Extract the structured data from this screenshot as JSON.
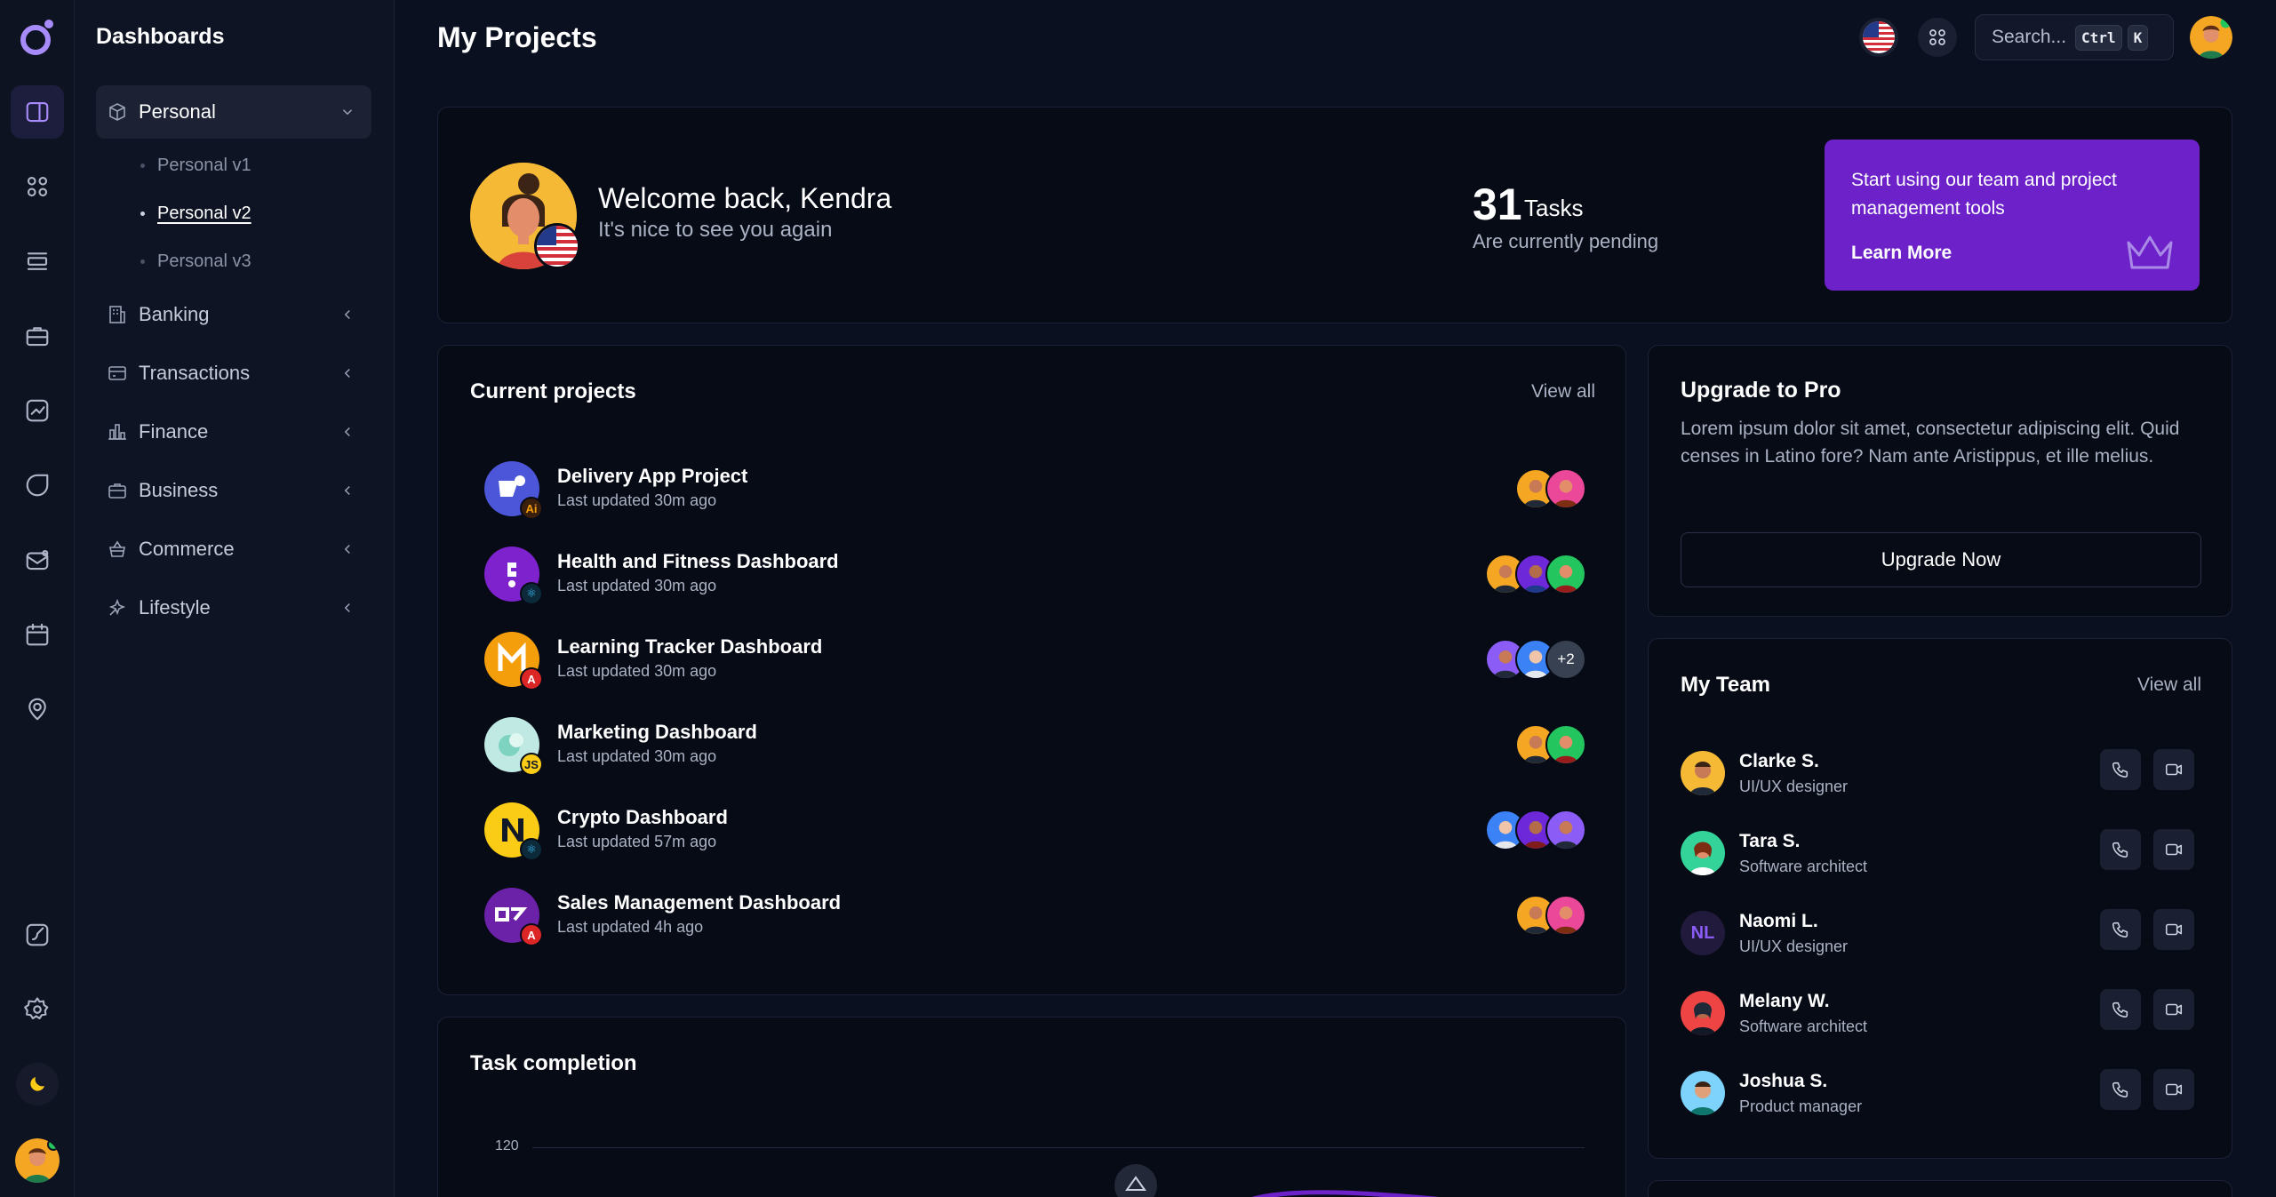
{
  "sidebar": {
    "title": "Dashboards",
    "groups": [
      {
        "label": "Personal",
        "icon": "box-icon",
        "expanded": true
      },
      {
        "label": "Banking",
        "icon": "building-icon"
      },
      {
        "label": "Transactions",
        "icon": "card-icon"
      },
      {
        "label": "Finance",
        "icon": "chart-bar-icon"
      },
      {
        "label": "Business",
        "icon": "briefcase-icon"
      },
      {
        "label": "Commerce",
        "icon": "basket-icon"
      },
      {
        "label": "Lifestyle",
        "icon": "sparkles-icon"
      }
    ],
    "personal_sub": [
      "Personal v1",
      "Personal v2",
      "Personal v3"
    ],
    "active_sub": "Personal v2"
  },
  "header": {
    "title": "My Projects",
    "search_label": "Search...",
    "kbd_ctrl": "Ctrl",
    "kbd_k": "K"
  },
  "welcome": {
    "title": "Welcome back, Kendra",
    "subtitle": "It's nice to see you again",
    "task_count": "31",
    "task_label": "Tasks",
    "task_sub": "Are currently pending",
    "promo_text": "Start using our team and project management tools",
    "promo_link": "Learn More"
  },
  "projects": {
    "title": "Current projects",
    "view_all": "View all",
    "items": [
      {
        "name": "Delivery App Project",
        "updated": "Last updated 30m ago",
        "badge": "Ai"
      },
      {
        "name": "Health and Fitness Dashboard",
        "updated": "Last updated 30m ago",
        "badge": "⚛"
      },
      {
        "name": "Learning Tracker Dashboard",
        "updated": "Last updated 30m ago",
        "badge": "A"
      },
      {
        "name": "Marketing Dashboard",
        "updated": "Last updated 30m ago",
        "badge": "JS"
      },
      {
        "name": "Crypto Dashboard",
        "updated": "Last updated 57m ago",
        "badge": "⚛"
      },
      {
        "name": "Sales Management Dashboard",
        "updated": "Last updated 4h ago",
        "badge": "A"
      }
    ],
    "extra_members": "+2"
  },
  "task_completion": {
    "title": "Task completion",
    "tick_top": "120"
  },
  "upgrade": {
    "title": "Upgrade to Pro",
    "body": "Lorem ipsum dolor sit amet, consectetur adipiscing elit. Quid censes in Latino fore? Nam ante Aristippus, et ille melius.",
    "button": "Upgrade Now"
  },
  "team": {
    "title": "My Team",
    "view_all": "View all",
    "members": [
      {
        "name": "Clarke S.",
        "role": "UI/UX designer"
      },
      {
        "name": "Tara S.",
        "role": "Software architect"
      },
      {
        "name": "Naomi L.",
        "role": "UI/UX designer",
        "initials": "NL"
      },
      {
        "name": "Melany W.",
        "role": "Software architect"
      },
      {
        "name": "Joshua S.",
        "role": "Product manager"
      }
    ]
  },
  "colors": {
    "accent": "#6d21c9",
    "accent_light": "#a78bfa",
    "background": "#0b1020",
    "card": "#070b16"
  }
}
